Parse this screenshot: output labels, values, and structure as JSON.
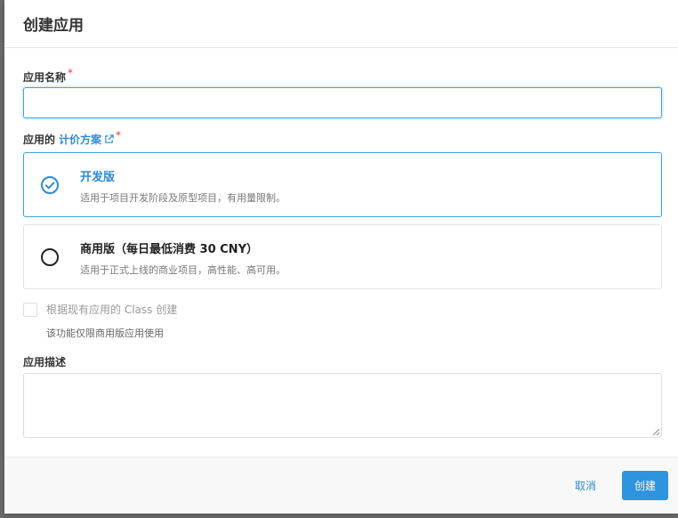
{
  "dialog": {
    "title": "创建应用"
  },
  "name_field": {
    "label": "应用名称",
    "required_mark": "*",
    "value": "",
    "placeholder": ""
  },
  "plan_field": {
    "label_prefix": "应用的",
    "link_text": "计价方案",
    "required_mark": "*",
    "options": [
      {
        "title": "开发版",
        "description": "适用于项目开发阶段及原型项目，有用量限制。",
        "selected": true
      },
      {
        "title": "商用版（每日最低消费 30 CNY）",
        "description": "适用于正式上线的商业项目，高性能、高可用。",
        "selected": false
      }
    ]
  },
  "class_option": {
    "label": "根据现有应用的 Class 创建",
    "hint": "该功能仅限商用版应用使用",
    "checked": false
  },
  "description_field": {
    "label": "应用描述",
    "value": ""
  },
  "footer": {
    "cancel_label": "取消",
    "create_label": "创建"
  },
  "colors": {
    "accent": "#2d8cd2",
    "primary_button": "#2e94dd",
    "required": "#e4393c"
  }
}
